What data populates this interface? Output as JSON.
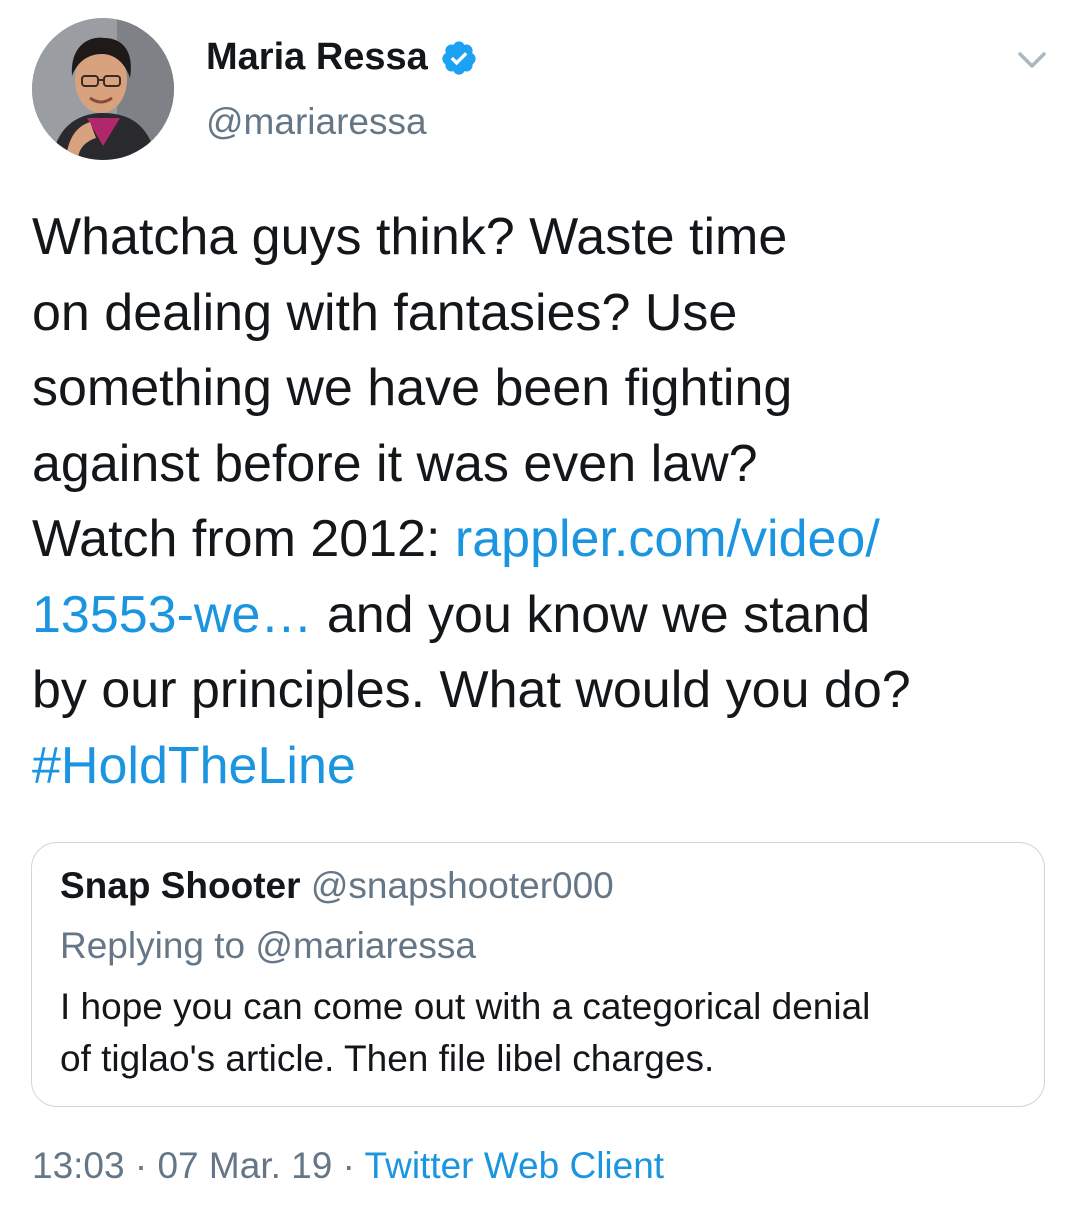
{
  "author": {
    "display_name": "Maria Ressa",
    "handle": "@mariaressa",
    "verified": true,
    "verified_icon": "verified-badge-icon",
    "more_icon": "chevron-down-icon"
  },
  "tweet": {
    "lines": [
      {
        "text": "Whatcha guys think? Waste time"
      },
      {
        "text": "on dealing with fantasies? Use"
      },
      {
        "text": "something we have been fighting"
      },
      {
        "text": "against before it was even law?"
      },
      {
        "text": "Watch from 2012: ",
        "link": "rappler.com/video/"
      },
      {
        "link": "13553-we…",
        "text": " and you know we stand"
      },
      {
        "text": "by our principles. What would you do?"
      },
      {
        "link": "#HoldTheLine"
      }
    ]
  },
  "quoted_tweet": {
    "display_name": "Snap Shooter",
    "handle": "@snapshooter000",
    "replying_prefix": "Replying to ",
    "replying_to": "@mariaressa",
    "text_lines": [
      "I hope you can come out with a categorical denial",
      "of tiglao's article. Then file libel charges."
    ]
  },
  "meta": {
    "time": "13:03",
    "separator": " · ",
    "date": "07 Mar. 19",
    "source": "Twitter Web Client"
  },
  "colors": {
    "link": "#1b95e0",
    "verified": "#1da1f2",
    "secondary_text": "#657786",
    "border": "#ccd6dd"
  }
}
